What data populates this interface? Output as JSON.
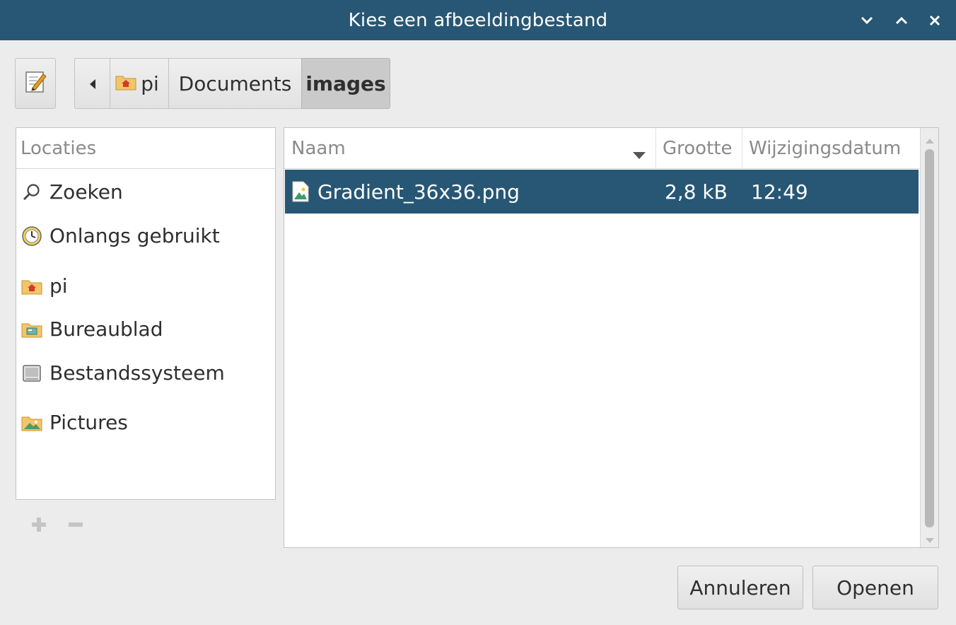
{
  "window": {
    "title": "Kies een afbeeldingbestand",
    "titlebar_color": "#275775",
    "controls": [
      "minimize-icon",
      "maximize-icon",
      "close-icon"
    ]
  },
  "toolbar": {
    "edit_icon": "edit-location-icon",
    "path": [
      {
        "label": "pi",
        "icon": "home-folder-icon"
      },
      {
        "label": "Documents"
      },
      {
        "label": "images",
        "active": true
      }
    ]
  },
  "places": {
    "header": "Locaties",
    "items": [
      {
        "label": "Zoeken",
        "icon": "search-icon"
      },
      {
        "label": "Onlangs gebruikt",
        "icon": "recent-icon"
      },
      {
        "label": "pi",
        "icon": "home-folder-icon"
      },
      {
        "label": "Bureaublad",
        "icon": "desktop-folder-icon"
      },
      {
        "label": "Bestandssysteem",
        "icon": "filesystem-icon"
      },
      {
        "label": "Pictures",
        "icon": "pictures-folder-icon"
      }
    ],
    "add_icon": "add-bookmark-icon",
    "remove_icon": "remove-bookmark-icon"
  },
  "files": {
    "columns": {
      "name": "Naam",
      "size": "Grootte",
      "date": "Wijzigingsdatum"
    },
    "sort": "name-descending-arrow",
    "rows": [
      {
        "name": "Gradient_36x36.png",
        "size": "2,8 kB",
        "date": "12:49",
        "icon": "image-file-icon",
        "selected": true
      }
    ]
  },
  "buttons": {
    "cancel": "Annuleren",
    "open": "Openen"
  },
  "colors": {
    "selection": "#275775",
    "background": "#ececec"
  }
}
